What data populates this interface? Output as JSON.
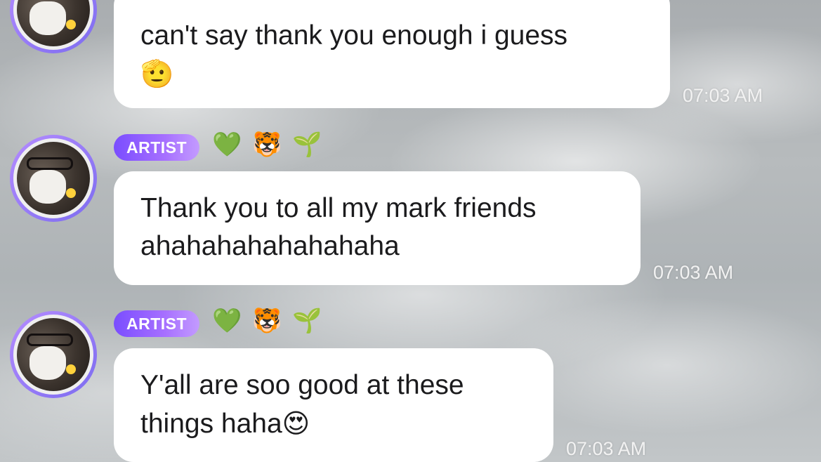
{
  "messages": [
    {
      "text": "can't say thank you enough i guess",
      "emoji": "🫡",
      "timestamp": "07:03 AM"
    },
    {
      "badge": "ARTIST",
      "reactions": [
        "💚",
        "🐯",
        "🌱"
      ],
      "text_line1": "Thank you to all my mark friends",
      "text_line2": "ahahahahahahahaha",
      "timestamp": "07:03 AM"
    },
    {
      "badge": "ARTIST",
      "reactions": [
        "💚",
        "🐯",
        "🌱"
      ],
      "text_line1": "Y'all are soo good at these",
      "text_line2": "things haha",
      "emoji": "😍",
      "timestamp": "07:03 AM"
    }
  ]
}
